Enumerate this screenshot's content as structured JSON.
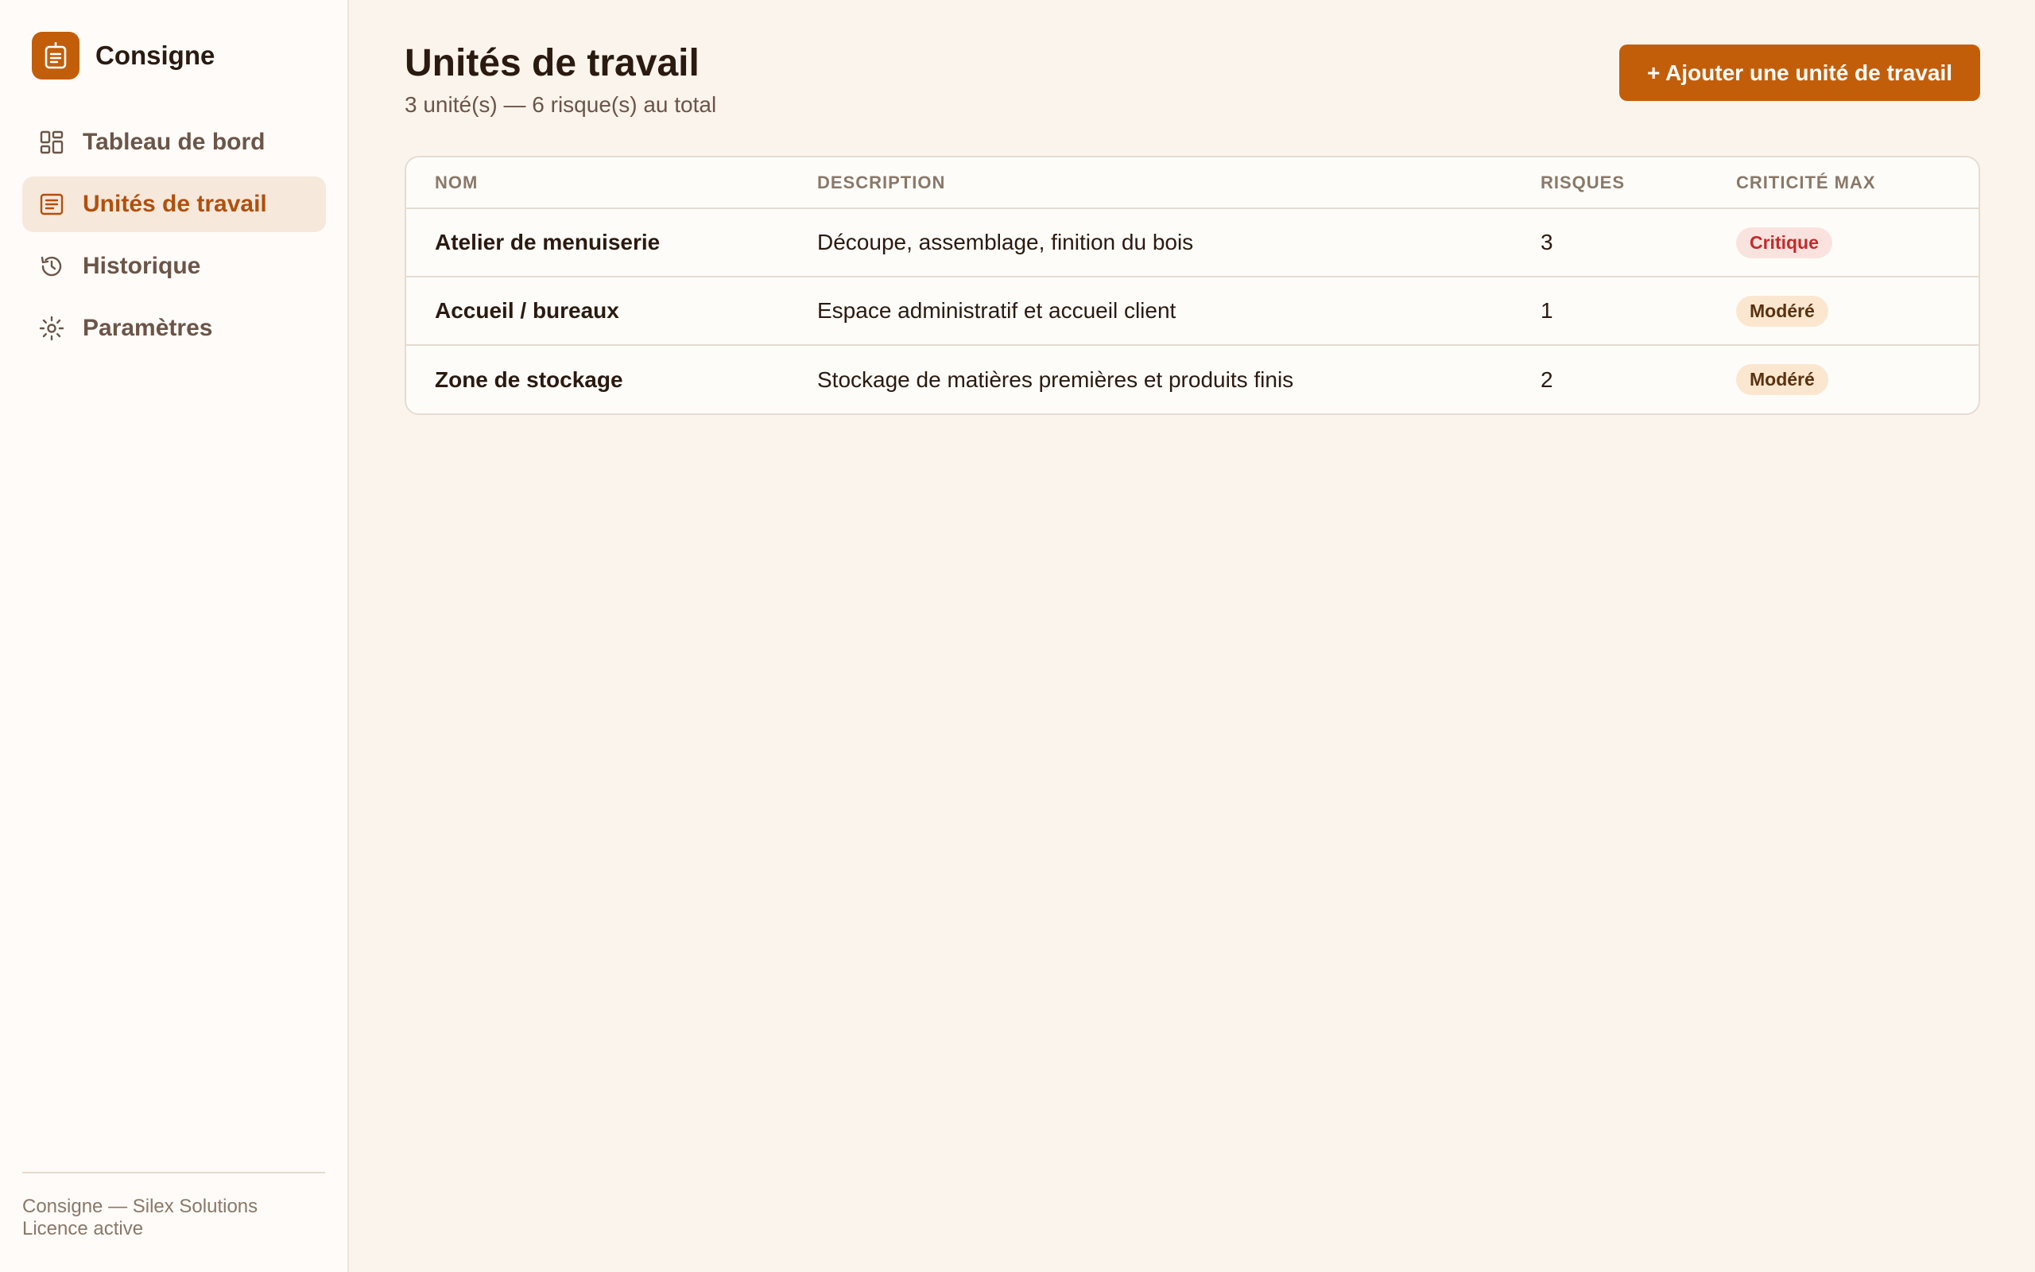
{
  "brand": {
    "name": "Consigne"
  },
  "sidebar": {
    "items": [
      {
        "label": "Tableau de bord",
        "icon": "dashboard-icon",
        "active": false
      },
      {
        "label": "Unités de travail",
        "icon": "list-icon",
        "active": true
      },
      {
        "label": "Historique",
        "icon": "history-icon",
        "active": false
      },
      {
        "label": "Paramètres",
        "icon": "gear-icon",
        "active": false
      }
    ],
    "footer": {
      "line1": "Consigne — Silex Solutions",
      "line2": "Licence active"
    }
  },
  "header": {
    "title": "Unités de travail",
    "subtitle": "3 unité(s) — 6 risque(s) au total",
    "add_button": "+ Ajouter une unité de travail"
  },
  "table": {
    "columns": [
      "Nom",
      "Description",
      "Risques",
      "Criticité max"
    ],
    "rows": [
      {
        "name": "Atelier de menuiserie",
        "description": "Découpe, assemblage, finition du bois",
        "risks": "3",
        "criticity": "Critique",
        "level": "critique"
      },
      {
        "name": "Accueil / bureaux",
        "description": "Espace administratif et accueil client",
        "risks": "1",
        "criticity": "Modéré",
        "level": "modere"
      },
      {
        "name": "Zone de stockage",
        "description": "Stockage de matières premières et produits finis",
        "risks": "2",
        "criticity": "Modéré",
        "level": "modere"
      }
    ]
  },
  "colors": {
    "accent": "#c25e0a",
    "critical": "#c42a2a",
    "moderate_bg": "#fbe7cf"
  }
}
